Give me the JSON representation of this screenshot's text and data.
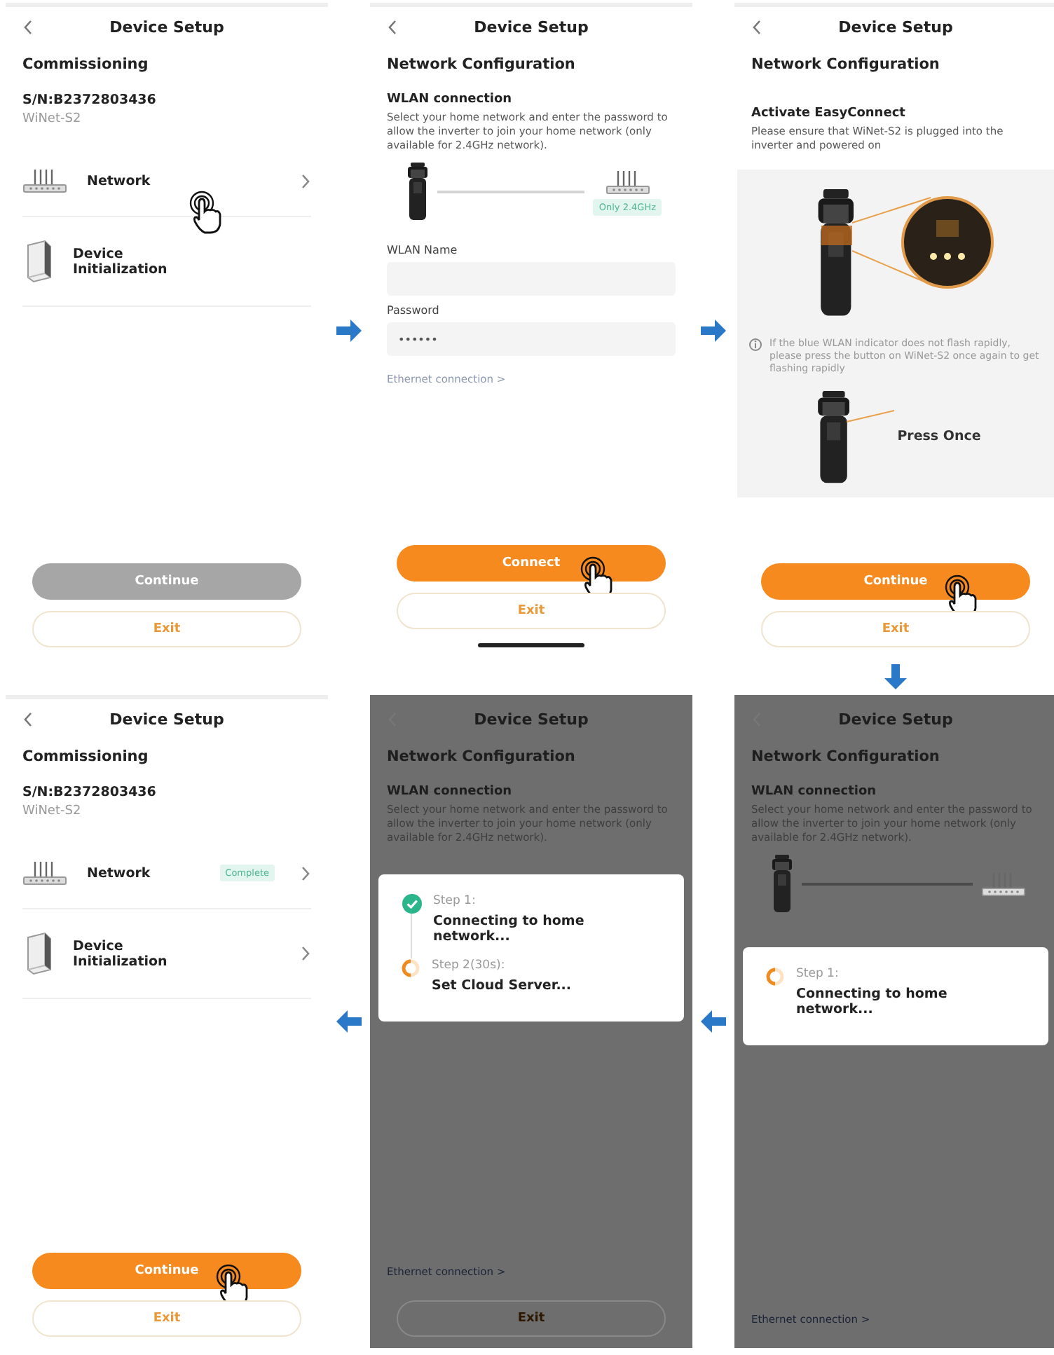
{
  "screens": [
    {
      "kind": "commissioning",
      "dimmed": false,
      "title": "Device Setup",
      "heading": "Commissioning",
      "serial": "S/N:B2372803436",
      "model": "WiNet-S2",
      "items": [
        {
          "kind": "router",
          "label": "Network",
          "chevron": true,
          "tapped": true
        },
        {
          "kind": "device",
          "label": "Device Initialization",
          "chevron": false
        }
      ],
      "buttons": [
        {
          "kind": "primary",
          "label": "Continue",
          "disabled": true
        },
        {
          "kind": "outline",
          "label": "Exit"
        }
      ]
    },
    {
      "kind": "network",
      "dimmed": false,
      "title": "Device Setup",
      "heading": "Network Configuration",
      "subheading": "WLAN connection",
      "description": "Select your home network and enter the password to allow the inverter to join your home network (only available for 2.4GHz network).",
      "diagram": true,
      "badge": "Only 2.4GHz",
      "fields": [
        {
          "label": "WLAN Name"
        },
        {
          "label": "Password",
          "value": "••••••"
        }
      ],
      "link": "Ethernet connection >",
      "buttons": [
        {
          "kind": "primary",
          "label": "Connect",
          "disabled": false,
          "tapped": true
        },
        {
          "kind": "outline",
          "label": "Exit"
        }
      ],
      "home_bar": true
    },
    {
      "kind": "easyconnect",
      "dimmed": false,
      "title": "Device Setup",
      "heading": "Network Configuration",
      "subheading": "Activate EasyConnect",
      "description": "Please ensure that WiNet-S2 is plugged into the inverter and powered on",
      "note": "If the blue WLAN indicator does not flash rapidly, please press the button on WiNet-S2 once again to get flashing rapidly",
      "press_label": "Press Once",
      "buttons": [
        {
          "kind": "primary",
          "label": "Continue",
          "disabled": false,
          "tapped": true
        },
        {
          "kind": "outline",
          "label": "Exit"
        }
      ]
    },
    {
      "kind": "commissioning",
      "dimmed": false,
      "title": "Device Setup",
      "heading": "Commissioning",
      "serial": "S/N:B2372803436",
      "model": "WiNet-S2",
      "items": [
        {
          "kind": "router",
          "label": "Network",
          "badge": "Complete",
          "chevron": true
        },
        {
          "kind": "device",
          "label": "Device Initialization",
          "chevron": true
        }
      ],
      "buttons": [
        {
          "kind": "primary",
          "label": "Continue",
          "disabled": false,
          "tapped": true
        },
        {
          "kind": "outline",
          "label": "Exit"
        }
      ]
    },
    {
      "kind": "network",
      "dimmed": true,
      "title": "Device Setup",
      "heading": "Network Configuration",
      "subheading": "WLAN connection",
      "description": "Select your home network and enter the password to allow the inverter to join your home network (only available for 2.4GHz network).",
      "dialog": {
        "steps": [
          {
            "done": true,
            "label": "Step 1:",
            "text": "Connecting to home network..."
          },
          {
            "done": false,
            "label": "Step 2(30s):",
            "text": "Set Cloud Server..."
          }
        ]
      },
      "link": "Ethernet connection >",
      "buttons": [
        {
          "kind": "outline",
          "label": "Exit"
        }
      ]
    },
    {
      "kind": "network",
      "dimmed": true,
      "title": "Device Setup",
      "heading": "Network Configuration",
      "subheading": "WLAN connection",
      "description": "Select your home network and enter the password to allow the inverter to join your home network (only available for 2.4GHz network).",
      "diagram": true,
      "dialog": {
        "steps": [
          {
            "done": false,
            "label": "Step 1:",
            "text": "Connecting to home network..."
          }
        ]
      },
      "link": "Ethernet connection >"
    }
  ]
}
